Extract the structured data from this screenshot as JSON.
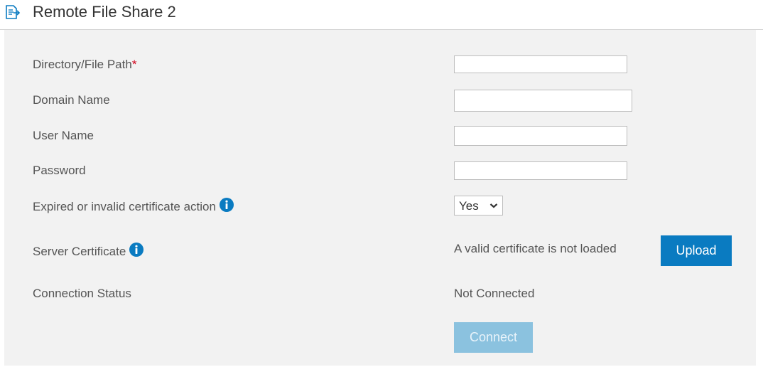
{
  "header": {
    "title": "Remote File Share 2",
    "icon": "document-share-icon"
  },
  "form": {
    "path_label": "Directory/File Path",
    "required_marker": "*",
    "domain_label": "Domain Name",
    "user_label": "User Name",
    "password_label": "Password",
    "cert_action_label": "Expired or invalid certificate action",
    "cert_action_value": "Yes",
    "server_cert_label": "Server Certificate",
    "server_cert_status": "A valid certificate is not loaded",
    "upload_label": "Upload",
    "conn_status_label": "Connection Status",
    "conn_status_value": "Not Connected",
    "connect_label": "Connect",
    "path_value": "",
    "domain_value": "",
    "user_value": "",
    "password_value": ""
  },
  "colors": {
    "accent": "#0a7bc1",
    "disabled_button": "#8bc2df",
    "required": "#d0021b",
    "panel_bg": "#f2f2f2"
  }
}
